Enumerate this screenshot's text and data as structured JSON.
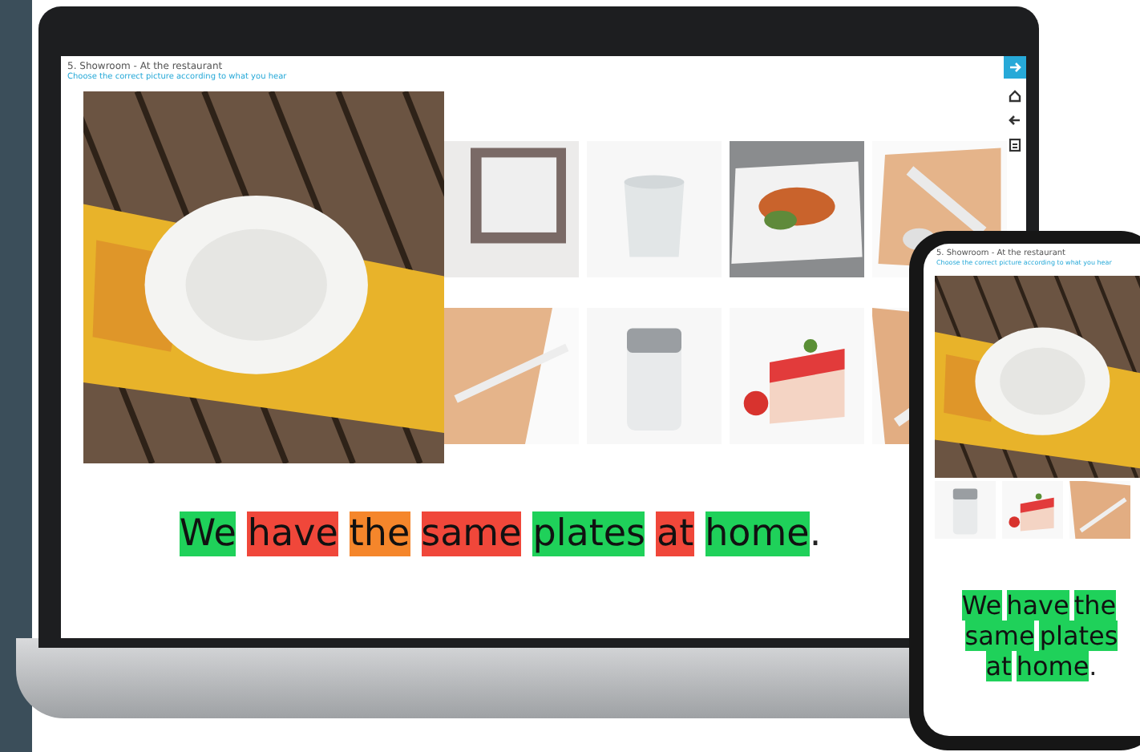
{
  "laptop": {
    "title": "5. Showroom - At the restaurant",
    "instruction": "Choose the correct picture according to what you hear",
    "sentence": [
      {
        "kind": "word",
        "text": "We",
        "color": "#1fd15a"
      },
      {
        "kind": "word",
        "text": "have",
        "color": "#f0473a"
      },
      {
        "kind": "word",
        "text": "the",
        "color": "#f5862b"
      },
      {
        "kind": "word",
        "text": "same",
        "color": "#f0473a"
      },
      {
        "kind": "word",
        "text": "plates",
        "color": "#1fd15a"
      },
      {
        "kind": "word",
        "text": "at",
        "color": "#f0473a"
      },
      {
        "kind": "word",
        "text": "home",
        "color": "#1fd15a"
      },
      {
        "kind": "punctuation",
        "text": "."
      }
    ]
  },
  "phone": {
    "title": "5. Showroom - At the restaurant",
    "instruction": "Choose the correct picture according to what you hear",
    "sentence": [
      {
        "kind": "word",
        "text": "We",
        "color": "#1fd15a"
      },
      {
        "kind": "word",
        "text": "have",
        "color": "#1fd15a"
      },
      {
        "kind": "word",
        "text": "the",
        "color": "#1fd15a"
      },
      {
        "kind": "word",
        "text": "same",
        "color": "#1fd15a"
      },
      {
        "kind": "word",
        "text": "plates",
        "color": "#1fd15a"
      },
      {
        "kind": "word",
        "text": "at",
        "color": "#1fd15a"
      },
      {
        "kind": "word",
        "text": "home",
        "color": "#1fd15a"
      },
      {
        "kind": "punctuation",
        "text": "."
      }
    ]
  }
}
